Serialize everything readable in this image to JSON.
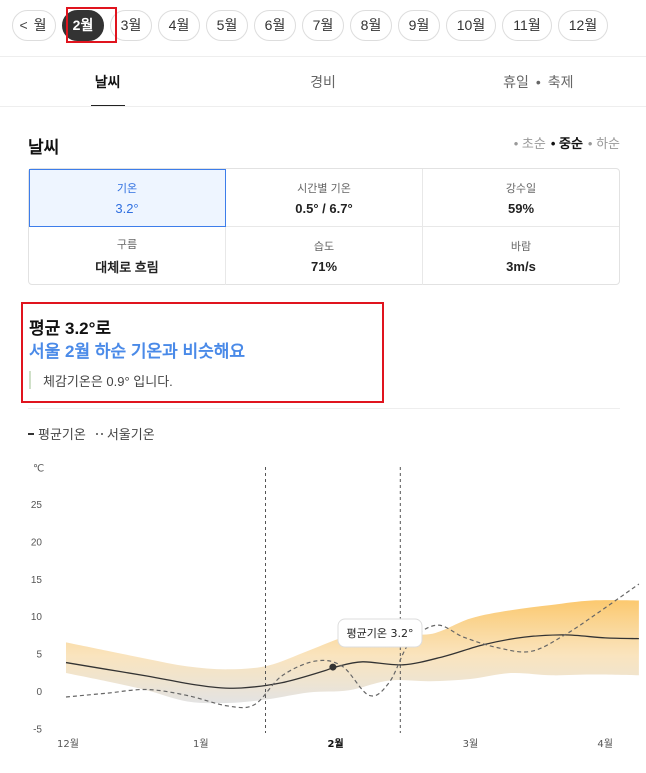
{
  "months": {
    "prev_partial": "월",
    "items": [
      "2월",
      "3월",
      "4월",
      "5월",
      "6월",
      "7월",
      "8월",
      "9월",
      "10월",
      "11월",
      "12월"
    ],
    "active": "2월"
  },
  "tabs": [
    {
      "label": "날씨",
      "active": true
    },
    {
      "label": "경비",
      "active": false
    },
    {
      "label": "휴일",
      "label2": "축제",
      "active": false
    }
  ],
  "section": {
    "title": "날씨",
    "periods": [
      "초순",
      "중순",
      "하순"
    ],
    "period_selected": "중순"
  },
  "stats": [
    {
      "label": "기온",
      "value": "3.2°",
      "active": true
    },
    {
      "label": "시간별 기온",
      "value": "0.5° / 6.7°"
    },
    {
      "label": "강수일",
      "value": "59%"
    },
    {
      "label": "구름",
      "value": "대체로 흐림"
    },
    {
      "label": "습도",
      "value": "71%"
    },
    {
      "label": "바람",
      "value": "3m/s"
    }
  ],
  "summary": {
    "line1": "평균 3.2°로",
    "line2": "서울 2월 하순 기온과 비슷해요",
    "note": "체감기온은 0.9° 입니다."
  },
  "legend": {
    "avg": "평균기온",
    "seoul": "서울기온"
  },
  "colors": {
    "accent": "#4a8ae8",
    "highlight_box": "#e0141e",
    "band_warm": "#fbc35e",
    "band_cool": "#d9d9d9"
  },
  "chart_data": {
    "type": "line",
    "ylabel": "℃",
    "yticks": [
      25,
      20,
      15,
      10,
      5,
      0,
      -5
    ],
    "ylim": [
      -5,
      30
    ],
    "x_ticks": [
      "12월",
      "1월",
      "2월",
      "3월",
      "4월"
    ],
    "x_tick_positions": [
      0,
      1,
      2,
      3,
      4
    ],
    "highlight_range": [
      1.48,
      2.48
    ],
    "tooltip": {
      "text": "평균기온 3.2°",
      "x": 1.98,
      "y": 3.2
    },
    "series": [
      {
        "name": "평균기온",
        "x": [
          0,
          0.3,
          0.6,
          0.9,
          1.1,
          1.3,
          1.6,
          1.9,
          2.0,
          2.2,
          2.5,
          2.8,
          3.1,
          3.4,
          3.7,
          4.0,
          4.25
        ],
        "y": [
          3.8,
          2.9,
          2.0,
          1.0,
          0.5,
          0.4,
          1.1,
          2.6,
          3.2,
          3.9,
          3.5,
          4.6,
          6.2,
          7.2,
          7.5,
          7.1,
          7.0
        ],
        "style": "solid"
      },
      {
        "name": "서울기온",
        "x": [
          0,
          0.3,
          0.6,
          0.9,
          1.2,
          1.4,
          1.6,
          1.85,
          2.05,
          2.25,
          2.4,
          2.55,
          2.75,
          2.95,
          3.2,
          3.45,
          3.7,
          3.95,
          4.25
        ],
        "y": [
          -0.8,
          -0.3,
          0.2,
          -0.6,
          -2.0,
          -1.8,
          2.0,
          4.0,
          3.3,
          -0.6,
          1.2,
          6.5,
          8.8,
          7.2,
          5.8,
          5.3,
          7.5,
          10.5,
          14.3
        ],
        "style": "dashed"
      }
    ],
    "range_band": {
      "x": [
        0,
        0.3,
        0.6,
        0.9,
        1.2,
        1.5,
        1.8,
        2.1,
        2.4,
        2.7,
        3.0,
        3.3,
        3.6,
        3.9,
        4.25
      ],
      "high": [
        6.5,
        5.4,
        4.3,
        3.3,
        2.9,
        3.4,
        5.4,
        7.4,
        8.0,
        7.6,
        9.7,
        10.8,
        11.5,
        12.1,
        12.1
      ],
      "low": [
        2.4,
        1.3,
        0.1,
        -1.4,
        -1.6,
        -1.1,
        -0.2,
        0.1,
        1.4,
        1.3,
        1.6,
        2.4,
        2.1,
        2.2,
        2.1
      ]
    }
  }
}
